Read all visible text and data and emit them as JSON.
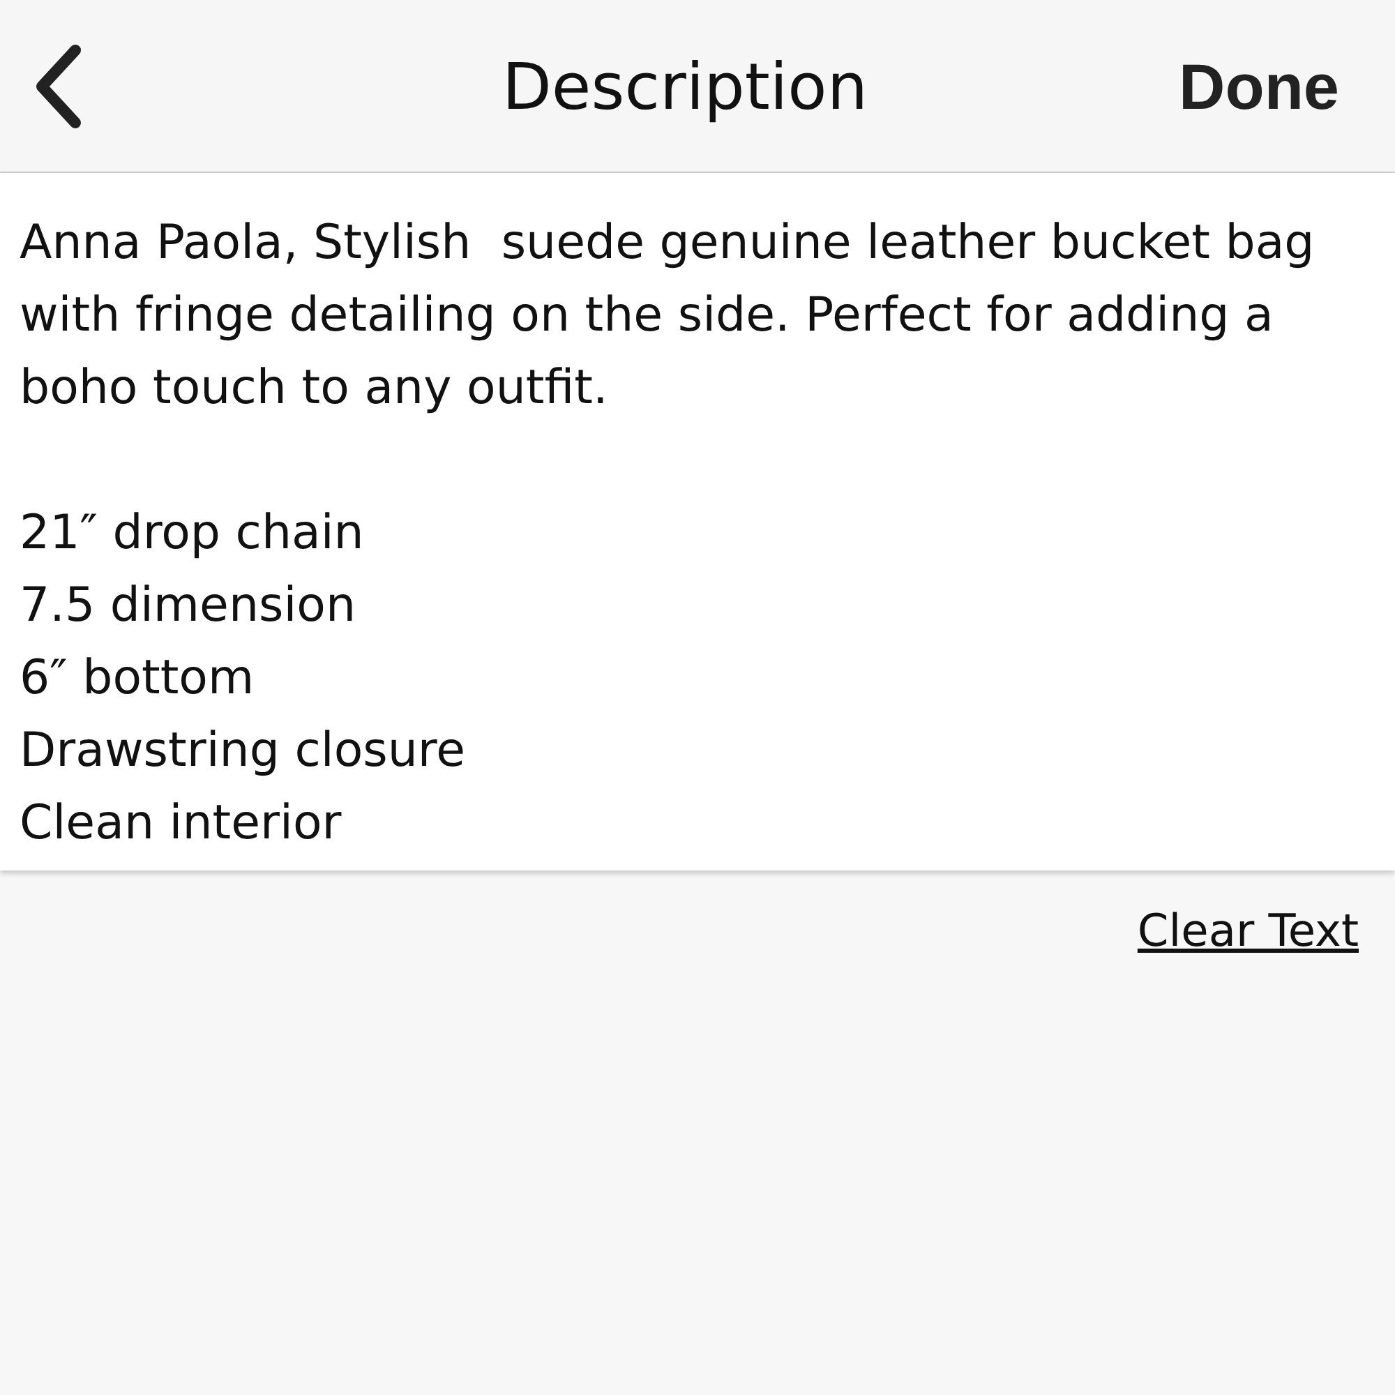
{
  "nav_bar": {
    "title": "Description",
    "done_button": "Done"
  },
  "description_field": {
    "value": "Anna Paola, Stylish  suede genuine leather bucket bag with fringe detailing on the side. Perfect for adding a boho touch to any outfit.\n\n21″ drop chain\n7.5 dimension\n6″ bottom\nDrawstring closure\nClean interior"
  },
  "clear_text_link": "Clear Text"
}
